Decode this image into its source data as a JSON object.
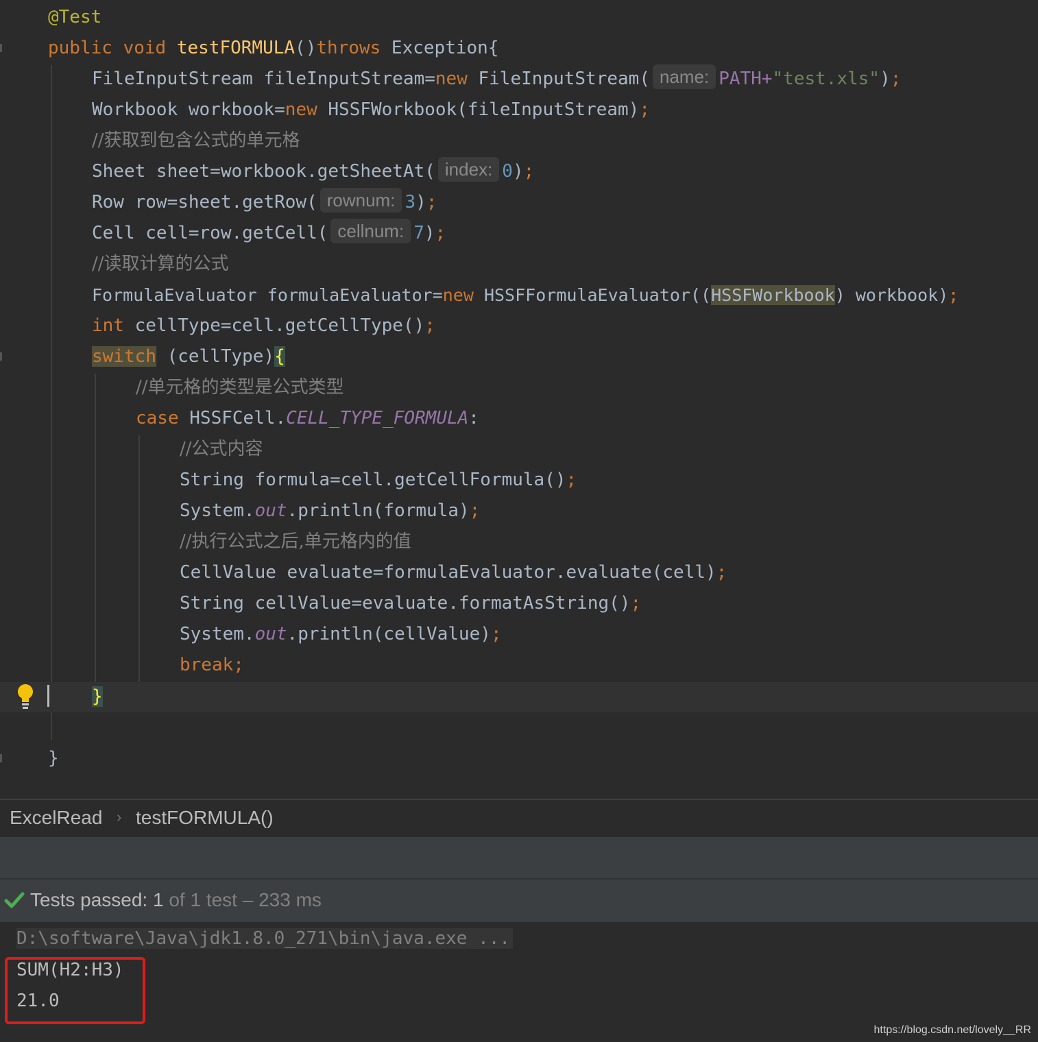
{
  "editor": {
    "lines": {
      "l1": {
        "ann": "@Test"
      },
      "l2": {
        "kw1": "public",
        "kw2": "void",
        "fn": "testFORMULA",
        "p1": "()",
        "kw3": "throws",
        "rest": " Exception{"
      },
      "l3": {
        "a": "FileInputStream fileInputStream=",
        "kw": "new",
        "b": " FileInputStream(",
        "hint": "name:",
        "c": "PATH+",
        "str": "\"test.xls\"",
        "d": ")",
        "sem": ";"
      },
      "l4": {
        "a": "Workbook workbook=",
        "kw": "new",
        "b": " HSSFWorkbook(fileInputStream)",
        "sem": ";"
      },
      "l5": {
        "cmt": "//获取到包含公式的单元格"
      },
      "l6": {
        "a": "Sheet sheet=workbook.getSheetAt(",
        "hint": "index:",
        "num": "0",
        "b": ")",
        "sem": ";"
      },
      "l7": {
        "a": "Row row=sheet.getRow(",
        "hint": "rownum:",
        "num": "3",
        "b": ")",
        "sem": ";"
      },
      "l8": {
        "a": "Cell cell=row.getCell(",
        "hint": "cellnum:",
        "num": "7",
        "b": ")",
        "sem": ";"
      },
      "l9": {
        "cmt": "//读取计算的公式"
      },
      "l10": {
        "a": "FormulaEvaluator formulaEvaluator=",
        "kw": "new",
        "b": " HSSFFormulaEvaluator((",
        "hl": "HSSFWorkbook",
        "c": ") workbook)",
        "sem": ";"
      },
      "l11": {
        "kw": "int",
        "a": " cellType=cell.getCellType()",
        "sem": ";"
      },
      "l12": {
        "kw": "switch",
        "a": " (cellType)",
        "brace": "{"
      },
      "l13": {
        "cmt": "//单元格的类型是公式类型"
      },
      "l14": {
        "kw": "case",
        "a": " HSSFCell.",
        "fld": "CELL_TYPE_FORMULA",
        "b": ":"
      },
      "l15": {
        "cmt": "//公式内容"
      },
      "l16": {
        "a": "String formula=cell.getCellFormula()",
        "sem": ";"
      },
      "l17": {
        "a": "System.",
        "fld": "out",
        "b": ".println(formula)",
        "sem": ";"
      },
      "l18": {
        "cmt": "//执行公式之后,单元格内的值"
      },
      "l19": {
        "a": "CellValue evaluate=formulaEvaluator.evaluate(cell)",
        "sem": ";"
      },
      "l20": {
        "a": "String cellValue=evaluate.formatAsString()",
        "sem": ";"
      },
      "l21": {
        "a": "System.",
        "fld": "out",
        "b": ".println(cellValue)",
        "sem": ";"
      },
      "l22": {
        "kw": "break",
        "sem": ";"
      },
      "l23": {
        "brace": "}"
      },
      "l24": {
        "brace": "}"
      }
    },
    "icons": {
      "gutter": "lightbulb-icon"
    }
  },
  "breadcrumb": {
    "class_name": "ExcelRead",
    "method_name": "testFORMULA()",
    "separator_icon": "chevron-right-icon"
  },
  "status": {
    "label": "Tests passed: ",
    "count": "1",
    "rest": " of 1 test – 233 ms",
    "icon": "check-icon",
    "icon_color": "#4caf50"
  },
  "console": {
    "cmd": "D:\\software\\Java\\jdk1.8.0_271\\bin\\java.exe ...",
    "out1": "SUM(H2:H3)",
    "out2": "21.0",
    "highlight_color": "#e01b1b"
  },
  "watermark": "https://blog.csdn.net/lovely__RR"
}
